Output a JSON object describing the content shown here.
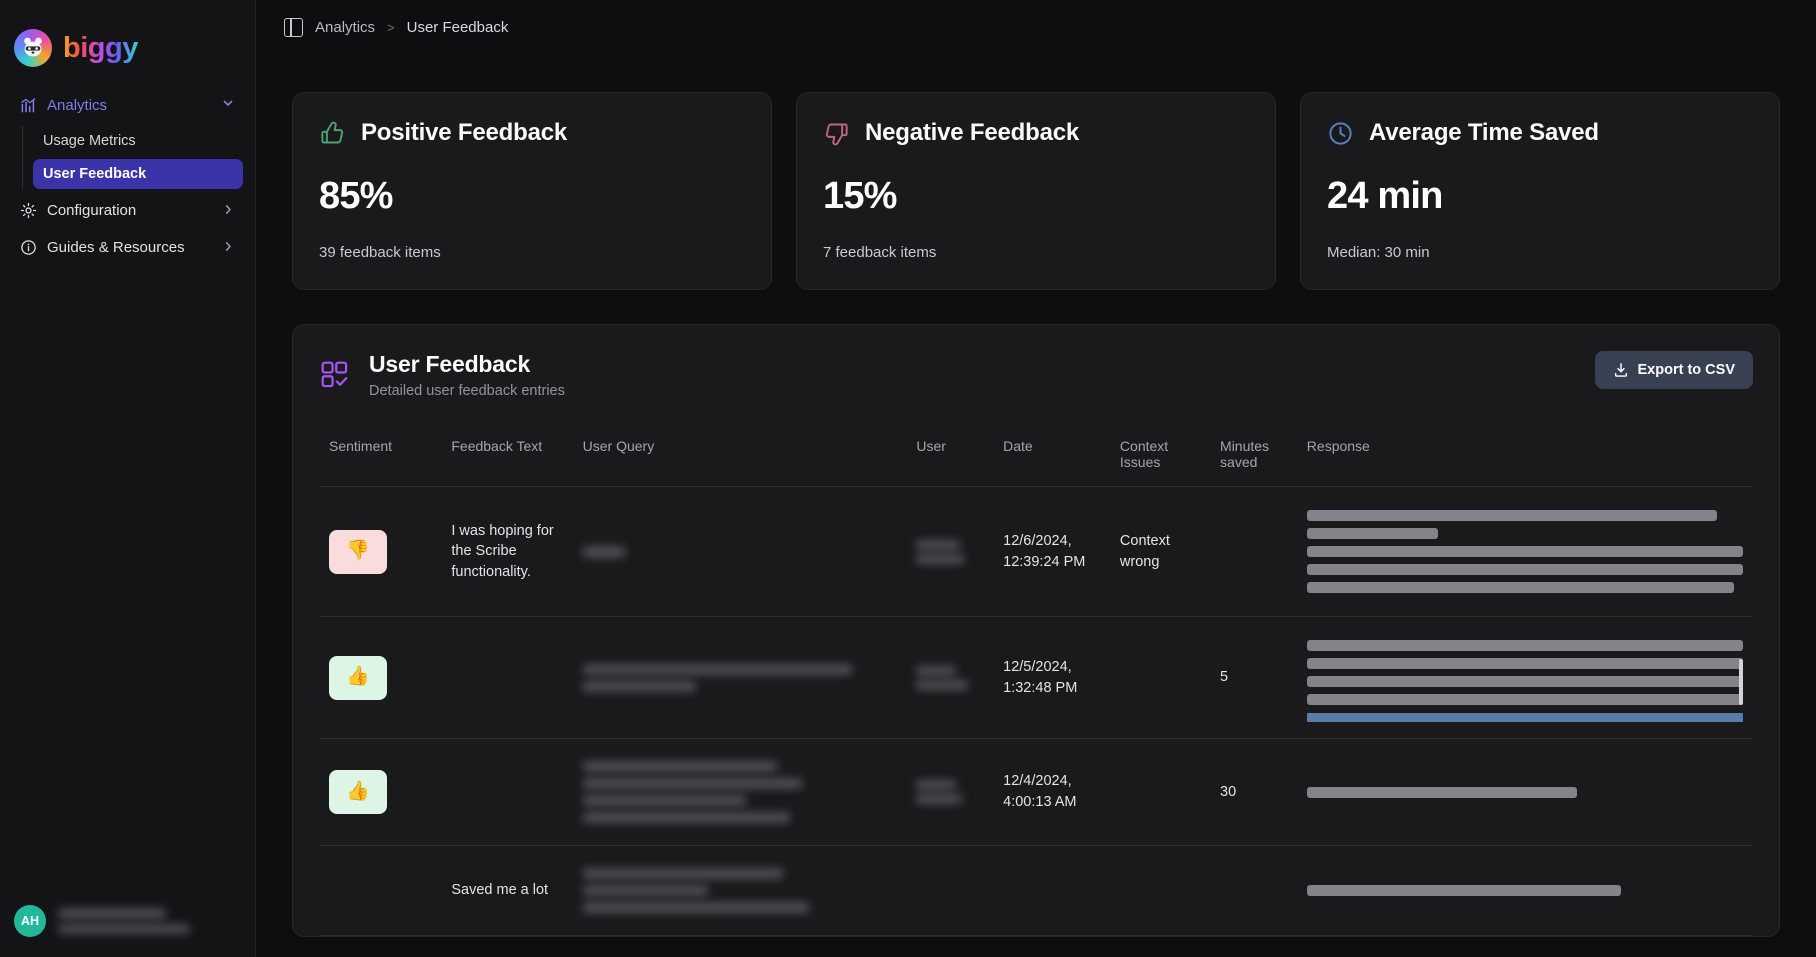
{
  "brand": {
    "name": "biggy",
    "logo_icon": "panda-logo-icon"
  },
  "sidebar": {
    "group": {
      "label": "Analytics",
      "icon": "chart-line-icon",
      "chevron": "chevron-down-icon"
    },
    "sub_items": [
      {
        "label": "Usage Metrics",
        "active": false
      },
      {
        "label": "User Feedback",
        "active": true
      }
    ],
    "items": [
      {
        "label": "Configuration",
        "icon": "gear-icon",
        "chevron": "chevron-right-icon"
      },
      {
        "label": "Guides & Resources",
        "icon": "info-circle-icon",
        "chevron": "chevron-right-icon"
      }
    ],
    "user": {
      "initials": "AH"
    }
  },
  "topbar": {
    "panel_toggle_icon": "panel-left-icon",
    "breadcrumb": {
      "root": "Analytics",
      "separator": ">",
      "current": "User Feedback"
    }
  },
  "cards": [
    {
      "icon": "thumbs-up-icon",
      "icon_color": "#4ea36f",
      "title": "Positive Feedback",
      "value": "85%",
      "sub": "39 feedback items"
    },
    {
      "icon": "thumbs-down-icon",
      "icon_color": "#c4657c",
      "title": "Negative Feedback",
      "value": "15%",
      "sub": "7 feedback items"
    },
    {
      "icon": "clock-icon",
      "icon_color": "#5b7fc4",
      "title": "Average Time Saved",
      "value": "24 min",
      "sub": "Median: 30 min"
    }
  ],
  "panel": {
    "icon": "table-check-icon",
    "icon_color": "#a855f7",
    "title": "User Feedback",
    "description": "Detailed user feedback entries",
    "export_button": {
      "label": "Export to CSV",
      "icon": "download-icon"
    }
  },
  "table": {
    "columns": [
      "Sentiment",
      "Feedback Text",
      "User Query",
      "User",
      "Date",
      "Context Issues",
      "Minutes saved",
      "Response"
    ],
    "rows": [
      {
        "sentiment": "negative",
        "sentiment_icon": "thumbs-down-icon",
        "feedback_text": "I was hoping for the Scribe functionality.",
        "user_query": "",
        "user": "",
        "date": "12/6/2024, 12:39:24 PM",
        "context_issues": "Context wrong",
        "minutes_saved": "",
        "response": ""
      },
      {
        "sentiment": "positive",
        "sentiment_icon": "thumbs-up-icon",
        "feedback_text": "",
        "user_query": "",
        "user": "",
        "date": "12/5/2024, 1:32:48 PM",
        "context_issues": "",
        "minutes_saved": "5",
        "response": ""
      },
      {
        "sentiment": "positive",
        "sentiment_icon": "thumbs-up-icon",
        "feedback_text": "",
        "user_query": "",
        "user": "",
        "date": "12/4/2024, 4:00:13 AM",
        "context_issues": "",
        "minutes_saved": "30",
        "response": ""
      },
      {
        "sentiment": "",
        "sentiment_icon": "",
        "feedback_text": "Saved me a lot",
        "user_query": "",
        "user": "",
        "date": "",
        "context_issues": "",
        "minutes_saved": "",
        "response": ""
      }
    ]
  }
}
